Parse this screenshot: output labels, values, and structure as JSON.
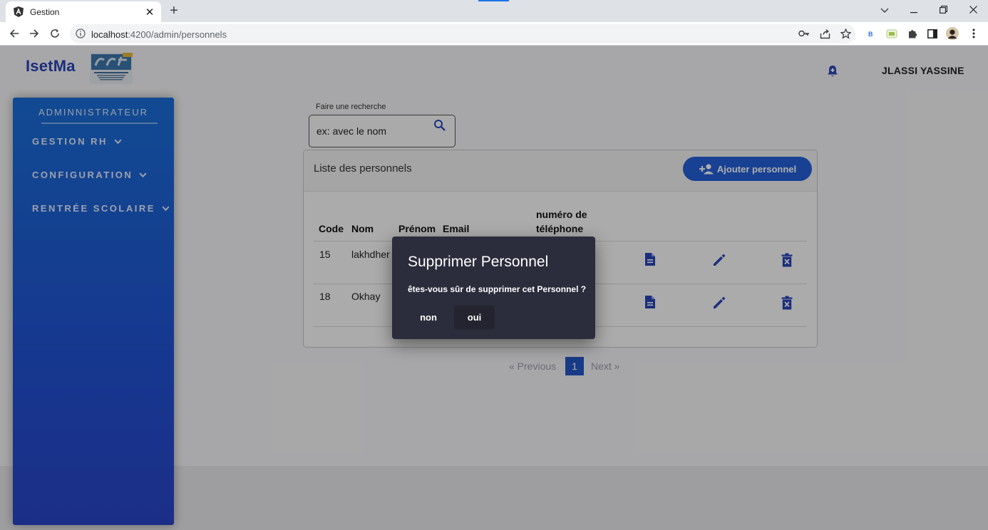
{
  "browser": {
    "tab_title": "Gestion",
    "tab_close": "✕",
    "new_tab": "+",
    "url_host": "localhost",
    "url_path": ":4200/admin/personnels",
    "window_controls": {
      "dropdown": "⌄",
      "minimize": "–",
      "restore": "❐",
      "close": "✕"
    }
  },
  "header": {
    "brand": "IsetMa",
    "user_name": "JLASSI YASSINE"
  },
  "sidebar": {
    "title": "ADMINNISTRATEUR",
    "items": [
      {
        "label": "GESTION RH"
      },
      {
        "label": "CONFIGURATION"
      },
      {
        "label": "RENTRÉE SCOLAIRE"
      }
    ]
  },
  "search": {
    "label": "Faire une recherche",
    "placeholder": "ex: avec le nom"
  },
  "list": {
    "title": "Liste des personnels",
    "add_button": "Ajouter personnel",
    "columns": {
      "code": "Code",
      "nom": "Nom",
      "prenom": "Prénom",
      "email": "Email",
      "telephone_1": "numéro de",
      "telephone_2": "téléphone"
    },
    "rows": [
      {
        "code": "15",
        "nom": "lakhdher"
      },
      {
        "code": "18",
        "nom": "Okhay"
      }
    ]
  },
  "pagination": {
    "previous": "« Previous",
    "current": "1",
    "next": "Next »"
  },
  "dialog": {
    "title": "Supprimer Personnel",
    "message": "êtes-vous sûr de supprimer cet Personnel ?",
    "cancel": "non",
    "confirm": "oui"
  },
  "colors": {
    "brand": "#2944b8",
    "sidebar": "#1a6ed8",
    "primary_button": "#2561d9",
    "action_icon": "#2944b8",
    "dialog_bg": "#2b2d3c"
  }
}
